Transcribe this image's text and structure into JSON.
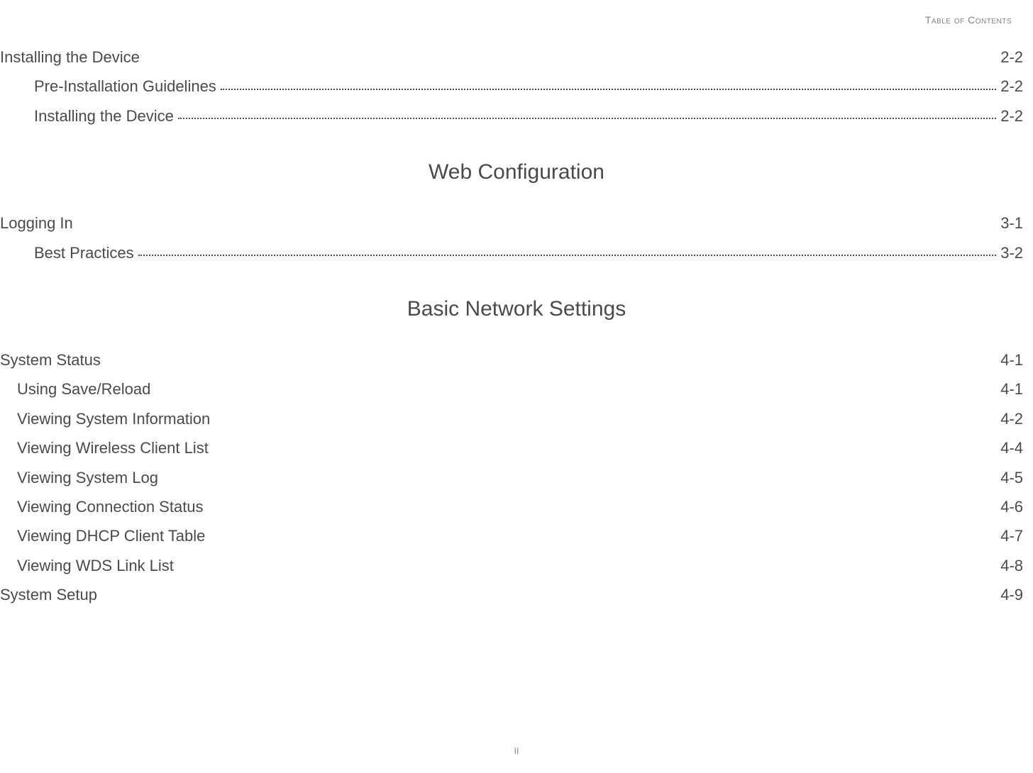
{
  "header": {
    "label": "Table of Contents"
  },
  "footer": {
    "page_number": "II"
  },
  "sections": [
    {
      "entries": [
        {
          "level": 0,
          "label": "Installing the Device",
          "page": "2-2",
          "dots": false
        },
        {
          "level": 2,
          "label": "Pre-Installation Guidelines",
          "page": "2-2",
          "dots": true
        },
        {
          "level": 2,
          "label": "Installing the Device",
          "page": "2-2",
          "dots": true
        }
      ]
    },
    {
      "heading": "Web Configuration",
      "entries": [
        {
          "level": 0,
          "label": "Logging In",
          "page": "3-1",
          "dots": false
        },
        {
          "level": 2,
          "label": "Best Practices",
          "page": "3-2",
          "dots": true
        }
      ]
    },
    {
      "heading": "Basic Network Settings",
      "entries": [
        {
          "level": 0,
          "label": "System Status",
          "page": "4-1",
          "dots": false
        },
        {
          "level": 1,
          "label": "Using Save/Reload",
          "page": "4-1",
          "dots": false
        },
        {
          "level": 1,
          "label": "Viewing System Information",
          "page": "4-2",
          "dots": false
        },
        {
          "level": 1,
          "label": "Viewing Wireless Client List",
          "page": "4-4",
          "dots": false
        },
        {
          "level": 1,
          "label": "Viewing System Log",
          "page": "4-5",
          "dots": false
        },
        {
          "level": 1,
          "label": "Viewing Connection Status",
          "page": "4-6",
          "dots": false
        },
        {
          "level": 1,
          "label": "Viewing DHCP Client Table",
          "page": "4-7",
          "dots": false
        },
        {
          "level": 1,
          "label": "Viewing WDS Link List",
          "page": "4-8",
          "dots": false
        },
        {
          "level": 0,
          "label": "System Setup",
          "page": "4-9",
          "dots": false
        }
      ]
    }
  ]
}
